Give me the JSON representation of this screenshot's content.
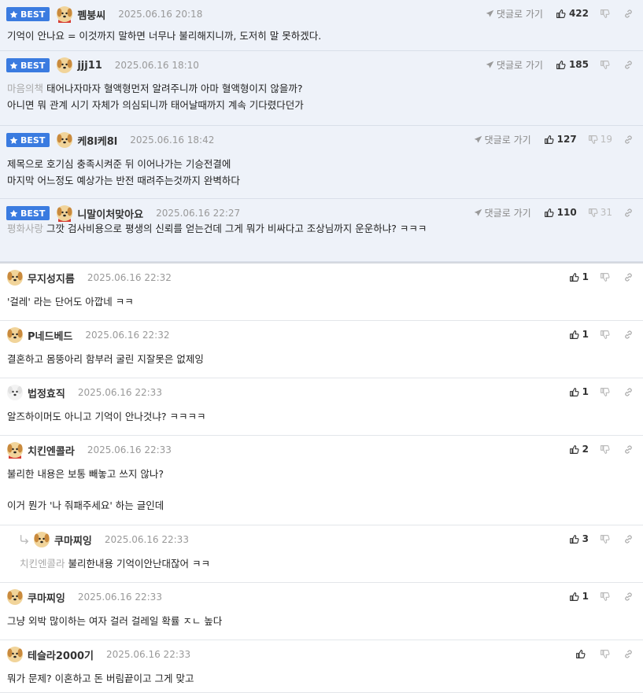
{
  "labels": {
    "best": "BEST",
    "goto": "댓글로 가기"
  },
  "colors": {
    "best_badge": "#3a7be0",
    "best_bg": "#eef2f9",
    "muted": "#999999"
  },
  "best_comments": [
    {
      "nick": "펨붕씨",
      "date": "2025.06.16 20:18",
      "avatar": "dog-cape",
      "up": "422",
      "down": "",
      "prefix": "",
      "lines": [
        "기억이 안나요 = 이것까지 말하면 너무나 불리해지니까, 도저히 말 못하겠다."
      ]
    },
    {
      "nick": "jjj11",
      "date": "2025.06.16 18:10",
      "avatar": "dog",
      "up": "185",
      "down": "",
      "prefix": "마음의책",
      "lines": [
        "태어나자마자 혈액형먼저 알려주니까 아마 혈액형이지 않을까?",
        "아니면 뭐 관계 시기 자체가 의심되니까 태어날때까지 계속 기다렸다던가"
      ]
    },
    {
      "nick": "케8l케8l",
      "date": "2025.06.16 18:42",
      "avatar": "dog",
      "up": "127",
      "down": "19",
      "prefix": "",
      "lines": [
        "제목으로 호기심 충족시켜준 뒤 이어나가는 기승전결에",
        "마지막 어느정도 예상가는 반전 때려주는것까지 완벽하다"
      ]
    },
    {
      "nick": "니말이처맞아요",
      "date": "2025.06.16 22:27",
      "avatar": "dog-cape",
      "up": "110",
      "down": "31",
      "prefix": "평화사랑",
      "lines": [
        "그깟 검사비용으로 평생의 신뢰를 얻는건데 그게 뭐가 비싸다고 조상님까지 운운하냐? ㅋㅋㅋ"
      ]
    }
  ],
  "comments": [
    {
      "nick": "무지성지름",
      "date": "2025.06.16 22:32",
      "avatar": "dog",
      "up": "1",
      "reply": false,
      "prefix": "",
      "lines": [
        "'걸레' 라는 단어도 아깝네 ㅋㅋ"
      ]
    },
    {
      "nick": "P네드베드",
      "date": "2025.06.16 22:32",
      "avatar": "dog",
      "up": "1",
      "reply": false,
      "prefix": "",
      "lines": [
        "결혼하고 몸뚱아리 함부러 굴린 지잘못은 없제잉"
      ]
    },
    {
      "nick": "법정효직",
      "date": "2025.06.16 22:33",
      "avatar": "white-dog",
      "up": "1",
      "reply": false,
      "prefix": "",
      "lines": [
        "알즈하이머도 아니고 기억이 안나것냐? ㅋㅋㅋㅋ"
      ]
    },
    {
      "nick": "치킨엔콜라",
      "date": "2025.06.16 22:33",
      "avatar": "dog-cape",
      "up": "2",
      "reply": false,
      "prefix": "",
      "lines": [
        "불리한 내용은 보통 빼놓고 쓰지 않나?",
        "",
        "이거 뭔가 '나 줘패주세요' 하는 글인데"
      ]
    },
    {
      "nick": "쿠마찌잉",
      "date": "2025.06.16 22:33",
      "avatar": "dog",
      "up": "3",
      "reply": true,
      "prefix": "치킨엔콜라",
      "lines": [
        "불리한내용 기억이안난대잖어 ㅋㅋ"
      ]
    },
    {
      "nick": "쿠마찌잉",
      "date": "2025.06.16 22:33",
      "avatar": "dog",
      "up": "1",
      "reply": false,
      "prefix": "",
      "lines": [
        "그냥 외박 많이하는 여자 걸러 걸레일 확률 ㅈㄴ 높다"
      ]
    },
    {
      "nick": "테슬라2000기",
      "date": "2025.06.16 22:33",
      "avatar": "dog",
      "up": "",
      "reply": false,
      "prefix": "",
      "lines": [
        "뭐가 문제? 이혼하고 돈 버림끝이고 그게 맞고"
      ]
    }
  ]
}
